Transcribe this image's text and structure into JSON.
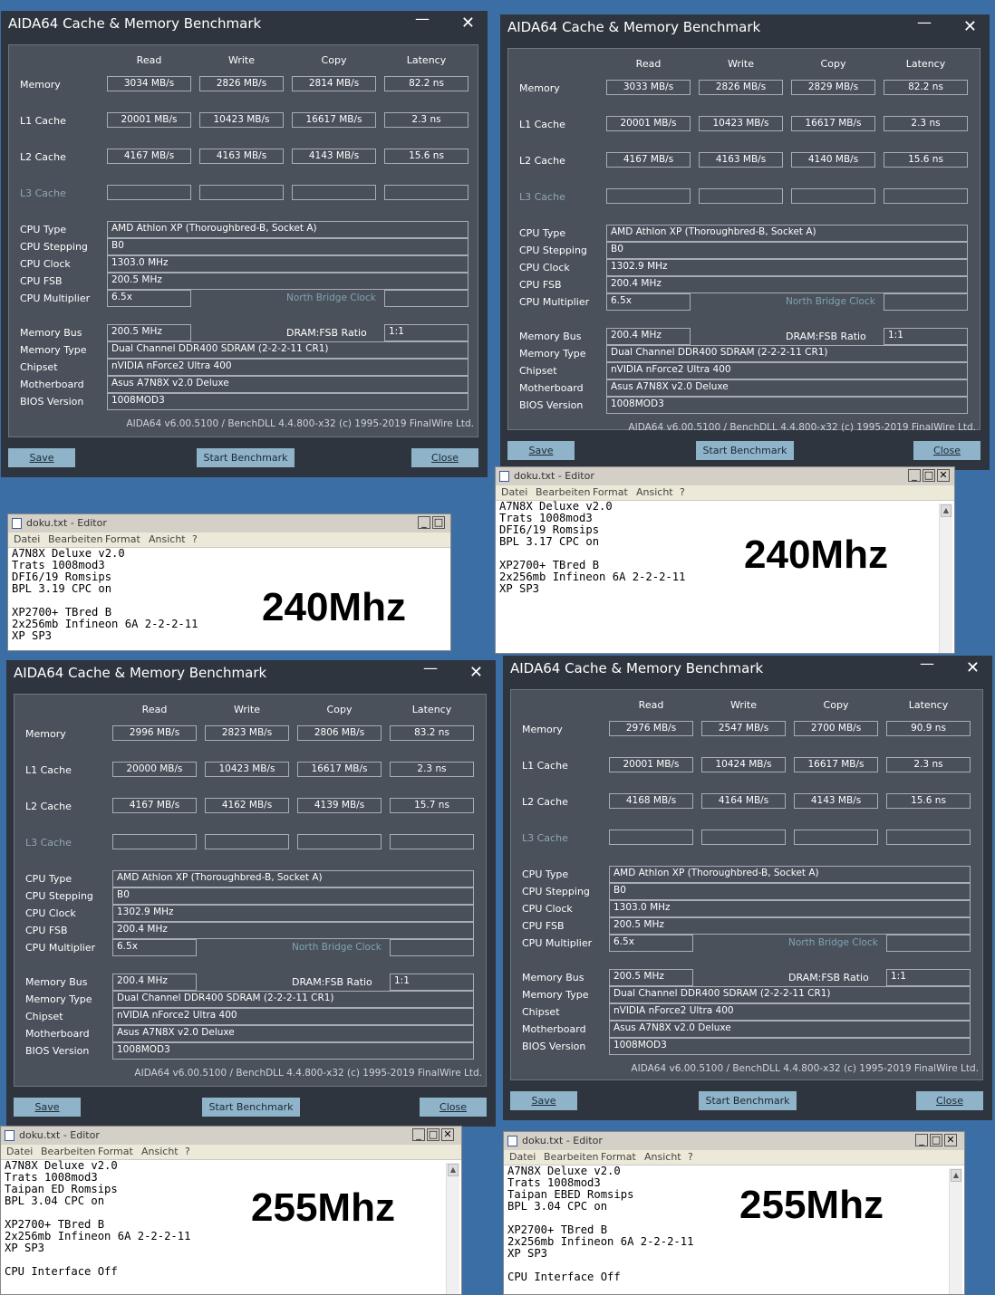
{
  "colors": {
    "desktop": "#3b6ea5",
    "aida_window": "#2f353e",
    "aida_panel": "#4a515a",
    "aida_button": "#8fb3c8",
    "notepad_menu": "#ece9d8"
  },
  "windows": [
    {
      "title": "AIDA64 Cache & Memory Benchmark",
      "headers": [
        "Read",
        "Write",
        "Copy",
        "Latency"
      ],
      "labels": {
        "memory": "Memory",
        "l1": "L1 Cache",
        "l2": "L2 Cache",
        "l3": "L3 Cache"
      },
      "memory": [
        "3034 MB/s",
        "2826 MB/s",
        "2814 MB/s",
        "82.2 ns"
      ],
      "l1": [
        "20001 MB/s",
        "10423 MB/s",
        "16617 MB/s",
        "2.3 ns"
      ],
      "l2": [
        "4167 MB/s",
        "4163 MB/s",
        "4143 MB/s",
        "15.6 ns"
      ],
      "cpu_labels": [
        "CPU Type",
        "CPU Stepping",
        "CPU Clock",
        "CPU FSB",
        "CPU Multiplier"
      ],
      "cpu_type": "AMD Athlon XP  (Thoroughbred-B, Socket A)",
      "cpu_stepping": "B0",
      "cpu_clock": "1303.0 MHz",
      "cpu_fsb": "200.5 MHz",
      "cpu_mult": "6.5x",
      "nb_clock": "North Bridge Clock",
      "mem_labels": [
        "Memory Bus",
        "Memory Type",
        "Chipset",
        "Motherboard",
        "BIOS Version"
      ],
      "mem_bus": "200.5 MHz",
      "dram_label": "DRAM:FSB Ratio",
      "dram_ratio": "1:1",
      "mem_type": "Dual Channel DDR400 SDRAM  (2-2-2-11 CR1)",
      "chipset": "nVIDIA nForce2 Ultra 400",
      "motherboard": "Asus A7N8X v2.0 Deluxe",
      "bios": "1008MOD3",
      "copyright": "AIDA64 v6.00.5100 / BenchDLL 4.4.800-x32  (c) 1995-2019 FinalWire Ltd.",
      "btn_save": "Save",
      "btn_start": "Start Benchmark",
      "btn_close": "Close",
      "close_glyph": "✕",
      "min_glyph": "—"
    },
    {
      "title": "AIDA64 Cache & Memory Benchmark",
      "headers": [
        "Read",
        "Write",
        "Copy",
        "Latency"
      ],
      "labels": {
        "memory": "Memory",
        "l1": "L1 Cache",
        "l2": "L2 Cache",
        "l3": "L3 Cache"
      },
      "memory": [
        "3033 MB/s",
        "2826 MB/s",
        "2829 MB/s",
        "82.2 ns"
      ],
      "l1": [
        "20001 MB/s",
        "10423 MB/s",
        "16617 MB/s",
        "2.3 ns"
      ],
      "l2": [
        "4167 MB/s",
        "4163 MB/s",
        "4140 MB/s",
        "15.6 ns"
      ],
      "cpu_labels": [
        "CPU Type",
        "CPU Stepping",
        "CPU Clock",
        "CPU FSB",
        "CPU Multiplier"
      ],
      "cpu_type": "AMD Athlon XP  (Thoroughbred-B, Socket A)",
      "cpu_stepping": "B0",
      "cpu_clock": "1302.9 MHz",
      "cpu_fsb": "200.4 MHz",
      "cpu_mult": "6.5x",
      "nb_clock": "North Bridge Clock",
      "mem_labels": [
        "Memory Bus",
        "Memory Type",
        "Chipset",
        "Motherboard",
        "BIOS Version"
      ],
      "mem_bus": "200.4 MHz",
      "dram_label": "DRAM:FSB Ratio",
      "dram_ratio": "1:1",
      "mem_type": "Dual Channel DDR400 SDRAM  (2-2-2-11 CR1)",
      "chipset": "nVIDIA nForce2 Ultra 400",
      "motherboard": "Asus A7N8X v2.0 Deluxe",
      "bios": "1008MOD3",
      "copyright": "AIDA64 v6.00.5100 / BenchDLL 4.4.800-x32  (c) 1995-2019 FinalWire Ltd.",
      "btn_save": "Save",
      "btn_start": "Start Benchmark",
      "btn_close": "Close",
      "close_glyph": "✕",
      "min_glyph": "—"
    },
    {
      "title": "AIDA64 Cache & Memory Benchmark",
      "headers": [
        "Read",
        "Write",
        "Copy",
        "Latency"
      ],
      "labels": {
        "memory": "Memory",
        "l1": "L1 Cache",
        "l2": "L2 Cache",
        "l3": "L3 Cache"
      },
      "memory": [
        "2996 MB/s",
        "2823 MB/s",
        "2806 MB/s",
        "83.2 ns"
      ],
      "l1": [
        "20000 MB/s",
        "10423 MB/s",
        "16617 MB/s",
        "2.3 ns"
      ],
      "l2": [
        "4167 MB/s",
        "4162 MB/s",
        "4139 MB/s",
        "15.7 ns"
      ],
      "cpu_labels": [
        "CPU Type",
        "CPU Stepping",
        "CPU Clock",
        "CPU FSB",
        "CPU Multiplier"
      ],
      "cpu_type": "AMD Athlon XP  (Thoroughbred-B, Socket A)",
      "cpu_stepping": "B0",
      "cpu_clock": "1302.9 MHz",
      "cpu_fsb": "200.4 MHz",
      "cpu_mult": "6.5x",
      "nb_clock": "North Bridge Clock",
      "mem_labels": [
        "Memory Bus",
        "Memory Type",
        "Chipset",
        "Motherboard",
        "BIOS Version"
      ],
      "mem_bus": "200.4 MHz",
      "dram_label": "DRAM:FSB Ratio",
      "dram_ratio": "1:1",
      "mem_type": "Dual Channel DDR400 SDRAM  (2-2-2-11 CR1)",
      "chipset": "nVIDIA nForce2 Ultra 400",
      "motherboard": "Asus A7N8X v2.0 Deluxe",
      "bios": "1008MOD3",
      "copyright": "AIDA64 v6.00.5100 / BenchDLL 4.4.800-x32  (c) 1995-2019 FinalWire Ltd.",
      "btn_save": "Save",
      "btn_start": "Start Benchmark",
      "btn_close": "Close",
      "close_glyph": "✕",
      "min_glyph": "—"
    },
    {
      "title": "AIDA64 Cache & Memory Benchmark",
      "headers": [
        "Read",
        "Write",
        "Copy",
        "Latency"
      ],
      "labels": {
        "memory": "Memory",
        "l1": "L1 Cache",
        "l2": "L2 Cache",
        "l3": "L3 Cache"
      },
      "memory": [
        "2976 MB/s",
        "2547 MB/s",
        "2700 MB/s",
        "90.9 ns"
      ],
      "l1": [
        "20001 MB/s",
        "10424 MB/s",
        "16617 MB/s",
        "2.3 ns"
      ],
      "l2": [
        "4168 MB/s",
        "4164 MB/s",
        "4143 MB/s",
        "15.6 ns"
      ],
      "cpu_labels": [
        "CPU Type",
        "CPU Stepping",
        "CPU Clock",
        "CPU FSB",
        "CPU Multiplier"
      ],
      "cpu_type": "AMD Athlon XP  (Thoroughbred-B, Socket A)",
      "cpu_stepping": "B0",
      "cpu_clock": "1303.0 MHz",
      "cpu_fsb": "200.5 MHz",
      "cpu_mult": "6.5x",
      "nb_clock": "North Bridge Clock",
      "mem_labels": [
        "Memory Bus",
        "Memory Type",
        "Chipset",
        "Motherboard",
        "BIOS Version"
      ],
      "mem_bus": "200.5 MHz",
      "dram_label": "DRAM:FSB Ratio",
      "dram_ratio": "1:1",
      "mem_type": "Dual Channel DDR400 SDRAM  (2-2-2-11 CR1)",
      "chipset": "nVIDIA nForce2 Ultra 400",
      "motherboard": "Asus A7N8X v2.0 Deluxe",
      "bios": "1008MOD3",
      "copyright": "AIDA64 v6.00.5100 / BenchDLL 4.4.800-x32  (c) 1995-2019 FinalWire Ltd.",
      "btn_save": "Save",
      "btn_start": "Start Benchmark",
      "btn_close": "Close",
      "close_glyph": "✕",
      "min_glyph": "—"
    }
  ],
  "notepads": [
    {
      "title": "doku.txt - Editor",
      "menu": [
        "Datei",
        "Bearbeiten",
        "Format",
        "Ansicht",
        "?"
      ],
      "text": "A7N8X Deluxe v2.0\nTrats 1008mod3\nDFI6/19 Romsips\nBPL 3.19 CPC on\n\nXP2700+ TBred B\n2x256mb Infineon 6A 2-2-2-11\nXP SP3",
      "big": "240Mhz",
      "btns": [
        "_",
        "□",
        "✕"
      ]
    },
    {
      "title": "doku.txt - Editor",
      "menu": [
        "Datei",
        "Bearbeiten",
        "Format",
        "Ansicht",
        "?"
      ],
      "text": "A7N8X Deluxe v2.0\nTrats 1008mod3\nDFI6/19 Romsips\nBPL 3.17 CPC on\n\nXP2700+ TBred B\n2x256mb Infineon 6A 2-2-2-11\nXP SP3",
      "big": "240Mhz",
      "btns": [
        "_",
        "□",
        "✕"
      ]
    },
    {
      "title": "doku.txt - Editor",
      "menu": [
        "Datei",
        "Bearbeiten",
        "Format",
        "Ansicht",
        "?"
      ],
      "text": "A7N8X Deluxe v2.0\nTrats 1008mod3\nTaipan ED Romsips\nBPL 3.04 CPC on\n\nXP2700+ TBred B\n2x256mb Infineon 6A 2-2-2-11\nXP SP3\n\nCPU Interface Off",
      "big": "255Mhz",
      "btns": [
        "_",
        "□",
        "✕"
      ]
    },
    {
      "title": "doku.txt - Editor",
      "menu": [
        "Datei",
        "Bearbeiten",
        "Format",
        "Ansicht",
        "?"
      ],
      "text": "A7N8X Deluxe v2.0\nTrats 1008mod3\nTaipan EBED Romsips\nBPL 3.04 CPC on\n\nXP2700+ TBred B\n2x256mb Infineon 6A 2-2-2-11\nXP SP3\n\nCPU Interface Off",
      "big": "255Mhz",
      "btns": [
        "_",
        "□",
        "✕"
      ]
    }
  ]
}
